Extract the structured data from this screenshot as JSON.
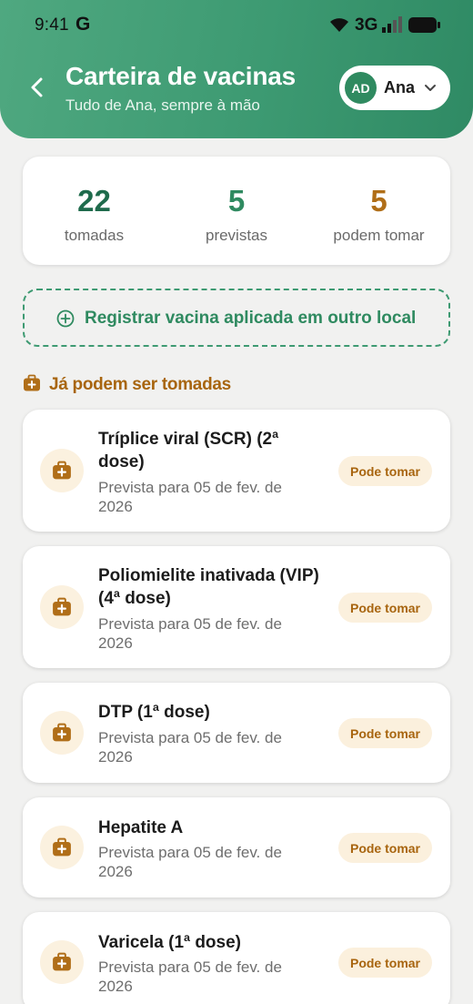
{
  "status_bar": {
    "time": "9:41",
    "app_icon_letter": "G",
    "network": "3G",
    "icons": [
      "wifi-icon",
      "signal-icon",
      "battery-icon"
    ]
  },
  "header": {
    "title": "Carteira de vacinas",
    "subtitle": "Tudo de Ana, sempre à mão",
    "back_icon": "chevron-left-icon",
    "profile": {
      "initials": "AD",
      "name": "Ana",
      "dropdown_icon": "chevron-down-icon"
    }
  },
  "stats": [
    {
      "value": "22",
      "label": "tomadas",
      "color": "#1f6b4c"
    },
    {
      "value": "5",
      "label": "previstas",
      "color": "#2f8a60"
    },
    {
      "value": "5",
      "label": "podem tomar",
      "color": "#b06e18"
    }
  ],
  "register_button": {
    "label": "Registrar vacina aplicada em outro local",
    "icon": "plus-circle-icon"
  },
  "section": {
    "title": "Já podem ser tomadas",
    "icon": "medical-kit-icon"
  },
  "vaccines": [
    {
      "name_line1": "Tríplice viral (SCR) (2ª",
      "name_line2": "dose)",
      "date_line1": "Prevista para 05 de fev. de",
      "date_line2": "2026",
      "badge": "Pode tomar"
    },
    {
      "name_line1": "Poliomielite inativada (VIP)",
      "name_line2": "(4ª dose)",
      "date_line1": "Prevista para 05 de fev. de",
      "date_line2": "2026",
      "badge": "Pode tomar"
    },
    {
      "name_line1": "DTP (1ª dose)",
      "name_line2": "",
      "date_line1": "Prevista para 05 de fev. de",
      "date_line2": "2026",
      "badge": "Pode tomar"
    },
    {
      "name_line1": "Hepatite A",
      "name_line2": "",
      "date_line1": "Prevista para 05 de fev. de",
      "date_line2": "2026",
      "badge": "Pode tomar"
    },
    {
      "name_line1": "Varicela (1ª dose)",
      "name_line2": "",
      "date_line1": "Prevista para 05 de fev. de",
      "date_line2": "2026",
      "badge": "Pode tomar"
    }
  ],
  "colors": {
    "brand_green": "#3d9a72",
    "accent_orange": "#a8650f",
    "badge_bg": "#fbf0dd"
  }
}
